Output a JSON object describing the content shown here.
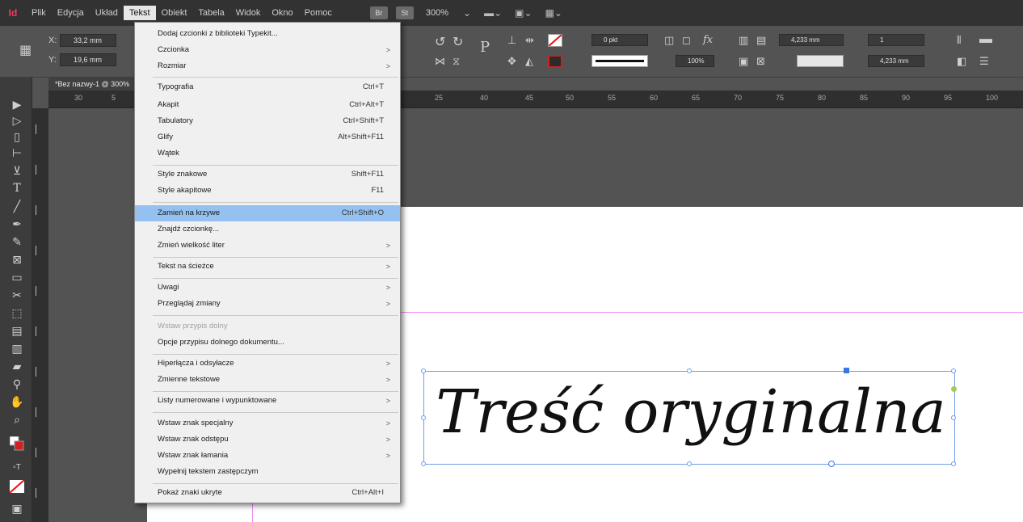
{
  "menubar": {
    "logo": "Id",
    "items": [
      "Plik",
      "Edycja",
      "Układ",
      "Tekst",
      "Obiekt",
      "Tabela",
      "Widok",
      "Okno",
      "Pomoc"
    ],
    "zoom": "300%",
    "btn_a": "Br",
    "btn_b": "St"
  },
  "control": {
    "x_label": "X:",
    "x_value": "33,2 mm",
    "y_label": "Y:",
    "y_value": "19,6 mm",
    "stroke_weight": "0 pkt",
    "opacity": "100%",
    "gap_w": "4,233 mm",
    "gap_h": "4,233 mm",
    "columns": "1"
  },
  "document_tab": "*Bez nazwy-1 @ 300%",
  "ruler_ticks": [
    "30",
    "5",
    "25",
    "40",
    "45",
    "50",
    "55",
    "60",
    "65",
    "70",
    "75",
    "80",
    "85",
    "90",
    "95",
    "100"
  ],
  "frame_text": "Treść oryginalna",
  "menu": {
    "items": [
      {
        "label": "Dodaj czcionki z biblioteki Typekit...",
        "shortcut": "",
        "submenu": false
      },
      {
        "label": "Czcionka",
        "shortcut": "",
        "submenu": true
      },
      {
        "label": "Rozmiar",
        "shortcut": "",
        "submenu": true
      },
      {
        "label": "Typografia",
        "shortcut": "Ctrl+T",
        "submenu": false
      },
      {
        "label": "Akapit",
        "shortcut": "Ctrl+Alt+T",
        "submenu": false
      },
      {
        "label": "Tabulatory",
        "shortcut": "Ctrl+Shift+T",
        "submenu": false
      },
      {
        "label": "Glify",
        "shortcut": "Alt+Shift+F11",
        "submenu": false
      },
      {
        "label": "Wątek",
        "shortcut": "",
        "submenu": false
      },
      {
        "label": "Style znakowe",
        "shortcut": "Shift+F11",
        "submenu": false
      },
      {
        "label": "Style akapitowe",
        "shortcut": "F11",
        "submenu": false
      },
      {
        "label": "Zamień na krzywe",
        "shortcut": "Ctrl+Shift+O",
        "submenu": false
      },
      {
        "label": "Znajdź czcionkę...",
        "shortcut": "",
        "submenu": false
      },
      {
        "label": "Zmień wielkość liter",
        "shortcut": "",
        "submenu": true
      },
      {
        "label": "Tekst na ścieżce",
        "shortcut": "",
        "submenu": true
      },
      {
        "label": "Uwagi",
        "shortcut": "",
        "submenu": true
      },
      {
        "label": "Przeglądaj zmiany",
        "shortcut": "",
        "submenu": true
      },
      {
        "label": "Wstaw przypis dolny",
        "shortcut": "",
        "submenu": false
      },
      {
        "label": "Opcje przypisu dolnego dokumentu...",
        "shortcut": "",
        "submenu": false
      },
      {
        "label": "Hiperłącza i odsyłacze",
        "shortcut": "",
        "submenu": true
      },
      {
        "label": "Zmienne tekstowe",
        "shortcut": "",
        "submenu": true
      },
      {
        "label": "Listy numerowane i wypunktowane",
        "shortcut": "",
        "submenu": true
      },
      {
        "label": "Wstaw znak specjalny",
        "shortcut": "",
        "submenu": true
      },
      {
        "label": "Wstaw znak odstępu",
        "shortcut": "",
        "submenu": true
      },
      {
        "label": "Wstaw znak łamania",
        "shortcut": "",
        "submenu": true
      },
      {
        "label": "Wypełnij tekstem zastępczym",
        "shortcut": "",
        "submenu": false
      },
      {
        "label": "Pokaż znaki ukryte",
        "shortcut": "Ctrl+Alt+I",
        "submenu": false
      }
    ]
  }
}
